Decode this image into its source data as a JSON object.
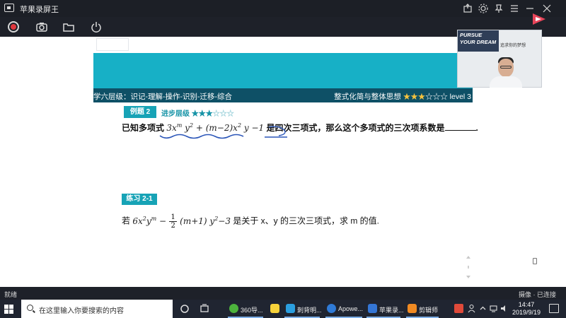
{
  "window": {
    "title": "苹果录屏王"
  },
  "slide": {
    "level_bar": {
      "left_text": "学六层级：识记-理解-操作-识别-迁移-综合",
      "topic": "整式化简与整体思想",
      "stars_filled": "★★★",
      "stars_empty": "☆☆☆",
      "level": "level 3"
    },
    "example": {
      "label": "例题 2",
      "level_prefix": "进步层级",
      "stars_filled": "★★★",
      "stars_empty": "☆☆☆",
      "text_before": "已知多项式",
      "math": "3x^m y^2 + (m−2)x^2 y −1",
      "text_after": "是四次三项式，那么这个多项式的三次项系数是",
      "period": "."
    },
    "practice": {
      "label": "练习 2-1",
      "prefix": "若",
      "frac_num": "1",
      "frac_den": "2",
      "suffix": "是关于 x、y 的三次三项式，求 m 的值."
    }
  },
  "webcam": {
    "banner_line1": "PURSUE",
    "banner_line2": "YOUR DREAM",
    "tagline": "追求你的梦想"
  },
  "statusbar": {
    "left": "就绪",
    "right": "摄像 · 已连接"
  },
  "taskbar": {
    "search_placeholder": "在这里输入你要搜索的内容",
    "items": [
      {
        "label": "360导...",
        "color": "#4db33d"
      },
      {
        "label": "刺背明...",
        "color": "#2b9fe0"
      },
      {
        "label": "Apowe...",
        "color": "#2f7bd8"
      },
      {
        "label": "苹果录...",
        "color": "#3476d6"
      },
      {
        "label": "剪辑师",
        "color": "#f08a22"
      }
    ],
    "time": "14:47",
    "date": "2019/9/19"
  },
  "colors": {
    "teal": "#17b0c6",
    "dark_teal": "#0e5066",
    "label_teal": "#17a3b6",
    "annotation_blue": "#2a55b8"
  }
}
